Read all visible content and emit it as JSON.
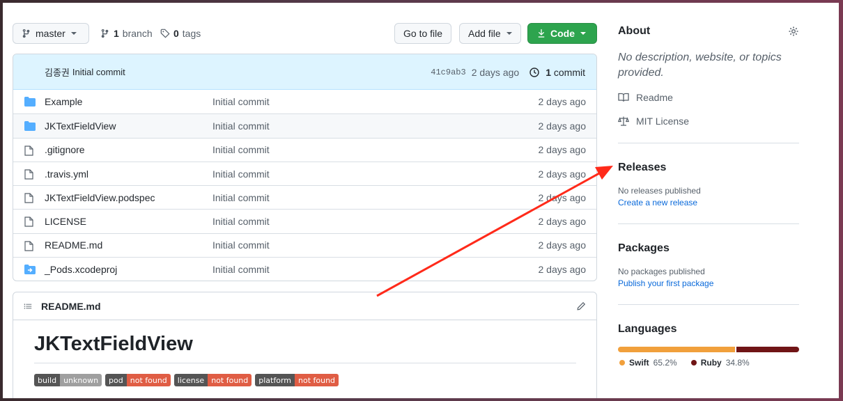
{
  "toolbar": {
    "branch_button": "master",
    "branch_count": "1",
    "branch_label": "branch",
    "tag_count": "0",
    "tag_label": "tags",
    "go_to_file": "Go to file",
    "add_file": "Add file",
    "code": "Code"
  },
  "commit": {
    "author": "김종권",
    "message": "Initial commit",
    "sha": "41c9ab3",
    "age": "2 days ago",
    "count": "1",
    "count_label": "commit"
  },
  "files": [
    {
      "name": "Example",
      "type": "dir",
      "message": "Initial commit",
      "age": "2 days ago"
    },
    {
      "name": "JKTextFieldView",
      "type": "dir",
      "message": "Initial commit",
      "age": "2 days ago"
    },
    {
      "name": ".gitignore",
      "type": "file",
      "message": "Initial commit",
      "age": "2 days ago"
    },
    {
      "name": ".travis.yml",
      "type": "file",
      "message": "Initial commit",
      "age": "2 days ago"
    },
    {
      "name": "JKTextFieldView.podspec",
      "type": "file",
      "message": "Initial commit",
      "age": "2 days ago"
    },
    {
      "name": "LICENSE",
      "type": "file",
      "message": "Initial commit",
      "age": "2 days ago"
    },
    {
      "name": "README.md",
      "type": "file",
      "message": "Initial commit",
      "age": "2 days ago"
    },
    {
      "name": "_Pods.xcodeproj",
      "type": "submodule",
      "message": "Initial commit",
      "age": "2 days ago"
    }
  ],
  "readme": {
    "filename": "README.md",
    "title": "JKTextFieldView",
    "badges": [
      {
        "label": "build",
        "value": "unknown",
        "color": "#9f9f9f"
      },
      {
        "label": "pod",
        "value": "not found",
        "color": "#e05d44"
      },
      {
        "label": "license",
        "value": "not found",
        "color": "#e05d44"
      },
      {
        "label": "platform",
        "value": "not found",
        "color": "#e05d44"
      }
    ]
  },
  "sidebar": {
    "about_title": "About",
    "description": "No description, website, or topics provided.",
    "readme_link": "Readme",
    "license_link": "MIT License",
    "releases_title": "Releases",
    "releases_empty": "No releases published",
    "releases_link": "Create a new release",
    "packages_title": "Packages",
    "packages_empty": "No packages published",
    "packages_link": "Publish your first package",
    "languages_title": "Languages",
    "languages": [
      {
        "name": "Swift",
        "percent": "65.2%",
        "share": 65.2,
        "color": "#F05138"
      },
      {
        "name": "Ruby",
        "percent": "34.8%",
        "share": 34.8,
        "color": "#701516"
      }
    ]
  },
  "colors": {
    "accent_green": "#2da44e",
    "link_blue": "#0969da",
    "annotation_arrow": "#ff2a1a",
    "swift_bar": "#f1a03c"
  }
}
